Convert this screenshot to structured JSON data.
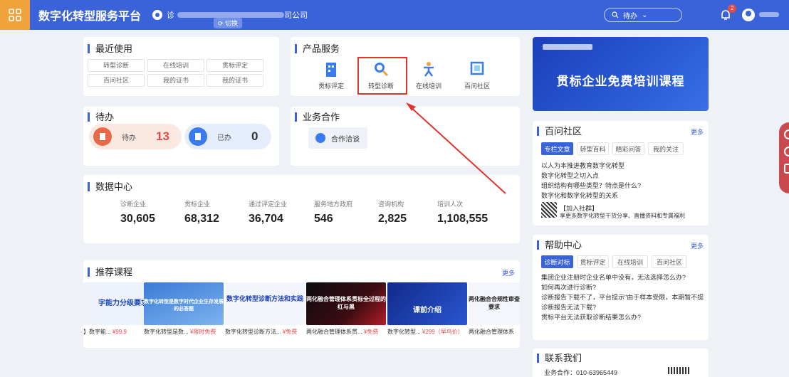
{
  "header": {
    "brand": "数字化转型服务平台",
    "company_prefix": "诊",
    "company_suffix": "司公司",
    "switch_label": "切换",
    "search_label": "待办",
    "bell_badge": "2"
  },
  "recent": {
    "title": "最近使用",
    "items": [
      "转型诊断",
      "在线培训",
      "贯标评定",
      "百问社区",
      "我的证书",
      "我的证书"
    ]
  },
  "products": {
    "title": "产品服务",
    "items": [
      "贯标评定",
      "转型诊断",
      "在线培训",
      "百问社区"
    ]
  },
  "todo": {
    "title": "待办",
    "pending_label": "待办",
    "pending_count": "13",
    "done_label": "已办",
    "done_count": "0"
  },
  "coop": {
    "title": "业务合作",
    "button": "合作洽谈"
  },
  "data_center": {
    "title": "数据中心",
    "stats": [
      {
        "label": "诊断企业",
        "value": "30,605"
      },
      {
        "label": "贯标企业",
        "value": "68,312"
      },
      {
        "label": "通过评定企业",
        "value": "36,704"
      },
      {
        "label": "服务地方政府",
        "value": "546"
      },
      {
        "label": "咨询机构",
        "value": "2,825"
      },
      {
        "label": "培训人次",
        "value": "1,108,555"
      }
    ]
  },
  "courses": {
    "title": "推荐课程",
    "more": "更多",
    "items": [
      {
        "thumb": "字能力分级要求",
        "name": "】数字能...",
        "price": "¥99.9"
      },
      {
        "thumb": "数字化转型是数字时代企业生存发展的必答题",
        "name": "数字化转型是数...",
        "price": "¥限时免费"
      },
      {
        "thumb": "数字化转型诊断方法和实践",
        "name": "数字化转型诊断方法...",
        "price": "¥免费"
      },
      {
        "thumb": "两化融合管理体系贯标全过程的红与黑",
        "name": "两化融合管理体系贯...",
        "price": "¥免费"
      },
      {
        "thumb": "课前介绍",
        "name": "数字化转型...",
        "price": "¥299（早鸟价）"
      },
      {
        "thumb": "两化融合合规性审查要求",
        "name": "两化融合管理体系",
        "price": ""
      }
    ]
  },
  "banner": {
    "text": "贯标企业免费培训课程"
  },
  "community": {
    "title": "百问社区",
    "more": "更多",
    "tabs": [
      "专栏文章",
      "转型百科",
      "精彩问答",
      "我的关注"
    ],
    "lines": [
      "以人为本推进教育数字化转型",
      "数字化转型之切入点",
      "组织结构有哪些类型？特点是什么?",
      "数字化和数字化转型的关系"
    ],
    "join_title": "【加入社群】",
    "join_desc": "享更多数字化转型干货分享、直播资料和专属福利"
  },
  "help": {
    "title": "帮助中心",
    "more": "更多",
    "tabs": [
      "诊断对标",
      "贯标评定",
      "在线培训",
      "百问社区"
    ],
    "lines": [
      "集团企业注册时企业名单中没有，无法选择怎么办?",
      "如何再次进行诊断?",
      "诊断报告下载不了，平台提示\"由于样本受限，本期暂不提供该行...",
      "诊断报告无法下载?",
      "贯标平台无法获取诊断结果怎么办?"
    ]
  },
  "contact": {
    "title": "联系我们",
    "line": "业务合作：010-63965449"
  },
  "colors": {
    "primary": "#3a62d9",
    "accent": "#f0a23b",
    "highlight": "#e0352b"
  }
}
